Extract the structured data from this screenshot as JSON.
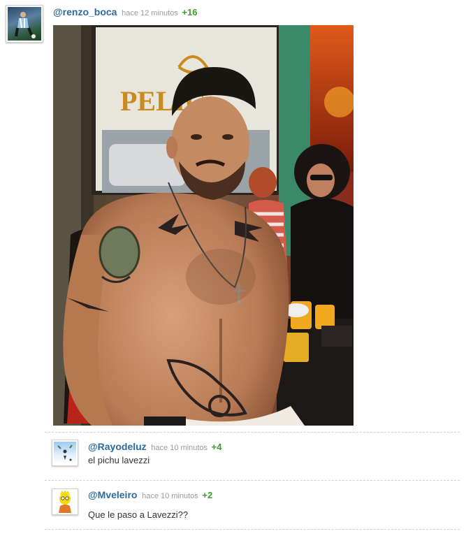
{
  "post": {
    "username": "@renzo_boca",
    "time": "hace 12 minutos",
    "score": "+16",
    "photo_text": "PELIC"
  },
  "comments": [
    {
      "username": "@Rayodeluz",
      "time": "hace 10 minutos",
      "score": "+4",
      "text": "el pichu lavezzi"
    },
    {
      "username": "@Mveleiro",
      "time": "hace 10 minutos",
      "score": "+2",
      "text": "Que le paso a Lavezzi??"
    }
  ],
  "colors": {
    "username": "#2b6a9c",
    "score": "#3c9a2b",
    "time": "#9a9a9a"
  }
}
